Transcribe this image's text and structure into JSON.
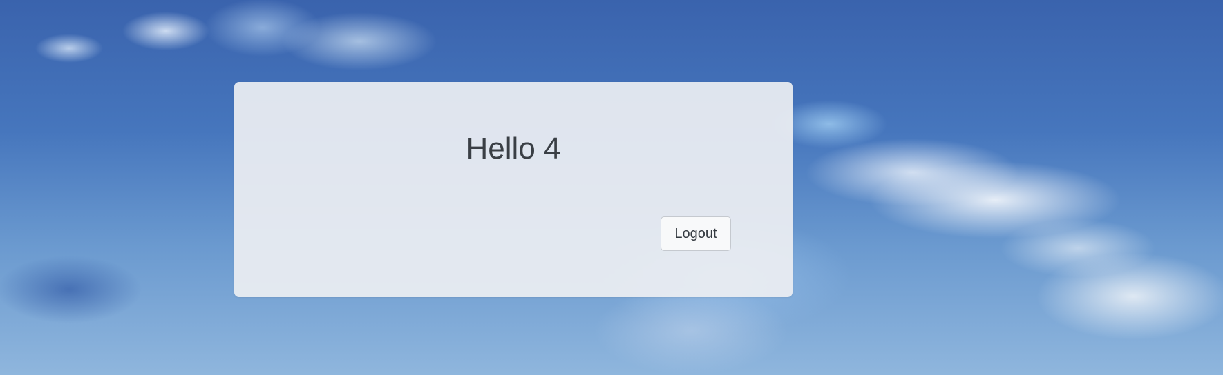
{
  "greeting": {
    "text": "Hello 4"
  },
  "actions": {
    "logout_label": "Logout"
  }
}
